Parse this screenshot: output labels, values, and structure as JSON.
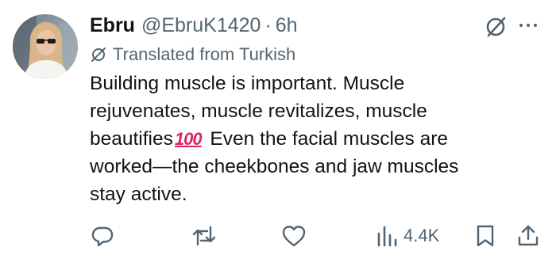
{
  "user": {
    "display_name": "Ebru",
    "handle": "@EbruK1420",
    "separator": "·",
    "time": "6h",
    "avatar_icon": "user-avatar"
  },
  "translation": {
    "label": "Translated from Turkish",
    "icon": "translate-icon"
  },
  "tweet": {
    "lines": [
      "Building muscle is important. Muscle",
      "rejuvenates, muscle revitalizes, muscle",
      "beautifies",
      " Even the facial muscles are",
      "worked—the cheekbones and jaw muscles",
      "stay active."
    ],
    "emoji": "100"
  },
  "actions": {
    "reply_icon": "reply-icon",
    "retweet_icon": "retweet-icon",
    "like_icon": "like-icon",
    "views_icon": "views-icon",
    "views_count": "4.4K",
    "bookmark_icon": "bookmark-icon",
    "share_icon": "share-icon"
  },
  "colors": {
    "text": "#0f1419",
    "secondary": "#536471",
    "emoji_red": "#e0245e"
  }
}
